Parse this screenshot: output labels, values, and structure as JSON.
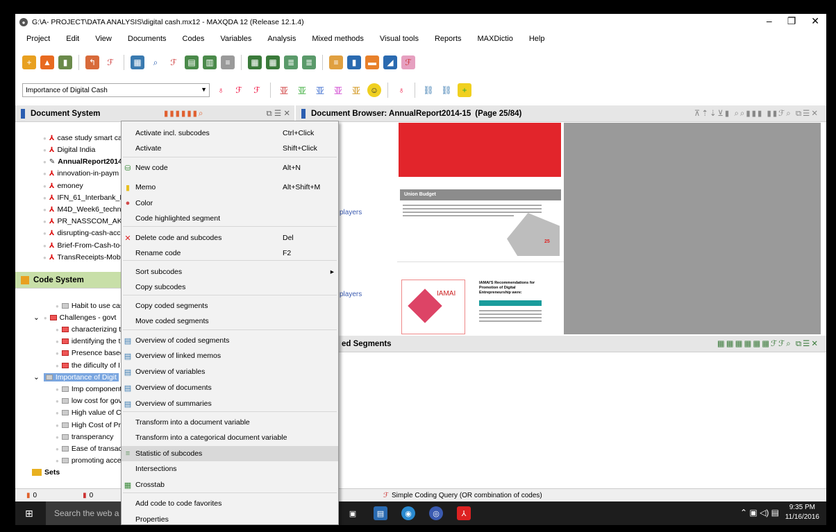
{
  "window": {
    "title": "G:\\A- PROJECT\\DATA ANALYSIS\\digital cash.mx12 - MAXQDA 12 (Release 12.1.4)",
    "controls": [
      "–",
      "❐",
      "✕"
    ]
  },
  "menu": [
    "Project",
    "Edit",
    "View",
    "Documents",
    "Codes",
    "Variables",
    "Analysis",
    "Mixed methods",
    "Visual tools",
    "Reports",
    "MAXDictio",
    "Help"
  ],
  "code_combo": {
    "value": "Importance of Digital Cash"
  },
  "document_system": {
    "title": "Document System",
    "items": [
      "case study smart car",
      "Digital India",
      "AnnualReport2014-",
      "innovation-in-paym",
      "emoney",
      "IFN_61_Interbank_M",
      "M4D_Week6_technc",
      "PR_NASSCOM_AKAM",
      "disrupting-cash-acc",
      "Brief-From-Cash-to-",
      "TransReceipts-Mobil"
    ]
  },
  "code_system": {
    "title": "Code System",
    "items": [
      "Habit to use cas",
      "Challenges - govt",
      "characterizing th",
      "identifying the t",
      "Presence based",
      "the dificulty of I",
      "Importance of Digit",
      "Imp component",
      "low cost for gov",
      "High value of Cu",
      "High Cost of Pri",
      "transperancy",
      "Ease of transact",
      "promoting acce",
      "Sets"
    ]
  },
  "document_browser": {
    "title": "Document Browser: AnnualReport2014-15",
    "page": "(Page 25/84)",
    "left_label_1": "l players",
    "left_label_2": "l players",
    "page_heading": "Union Budget",
    "page_number": "25",
    "logo_text": "IAMAI",
    "side_heading": "IAMAI'S Recommendations for Promotion of Digital Entrepreneurship were:"
  },
  "retrieved_segments": {
    "title": "ed Segments"
  },
  "context_menu": {
    "items": [
      {
        "label": "Activate incl. subcodes",
        "shortcut": "Ctrl+Click",
        "icon": ""
      },
      {
        "label": "Activate",
        "shortcut": "Shift+Click",
        "icon": ""
      },
      {
        "label": "New code",
        "shortcut": "Alt+N",
        "icon": "new-code"
      },
      {
        "label": "Memo",
        "shortcut": "Alt+Shift+M",
        "icon": "memo"
      },
      {
        "label": "Color",
        "shortcut": "",
        "icon": "color"
      },
      {
        "label": "Code highlighted segment",
        "shortcut": "",
        "icon": ""
      },
      {
        "label": "Delete code and subcodes",
        "shortcut": "Del",
        "icon": "delete"
      },
      {
        "label": "Rename code",
        "shortcut": "F2",
        "icon": ""
      },
      {
        "label": "Sort subcodes",
        "shortcut": "",
        "icon": ""
      },
      {
        "label": "Copy subcodes",
        "shortcut": "",
        "icon": ""
      },
      {
        "label": "Copy coded segments",
        "shortcut": "",
        "icon": ""
      },
      {
        "label": "Move coded segments",
        "shortcut": "",
        "icon": ""
      },
      {
        "label": "Overview of coded segments",
        "shortcut": "",
        "icon": "overview"
      },
      {
        "label": "Overview of linked memos",
        "shortcut": "",
        "icon": "overview"
      },
      {
        "label": "Overview of variables",
        "shortcut": "",
        "icon": "overview"
      },
      {
        "label": "Overview of documents",
        "shortcut": "",
        "icon": "overview"
      },
      {
        "label": "Overview of summaries",
        "shortcut": "",
        "icon": "overview"
      },
      {
        "label": "Transform into a document variable",
        "shortcut": "",
        "icon": ""
      },
      {
        "label": "Transform into a categorical document variable",
        "shortcut": "",
        "icon": ""
      },
      {
        "label": "Statistic of subcodes",
        "shortcut": "",
        "icon": "stats"
      },
      {
        "label": "Intersections",
        "shortcut": "",
        "icon": ""
      },
      {
        "label": "Crosstab",
        "shortcut": "",
        "icon": "crosstab"
      },
      {
        "label": "Add code to code favorites",
        "shortcut": "",
        "icon": ""
      },
      {
        "label": "Properties",
        "shortcut": "",
        "icon": ""
      }
    ]
  },
  "status": {
    "doc_count": "0",
    "code_count": "0",
    "query": "Simple Coding Query (OR combination of codes)"
  },
  "taskbar": {
    "search_placeholder": "Search the web a",
    "time": "9:35 PM",
    "date": "11/16/2016"
  }
}
